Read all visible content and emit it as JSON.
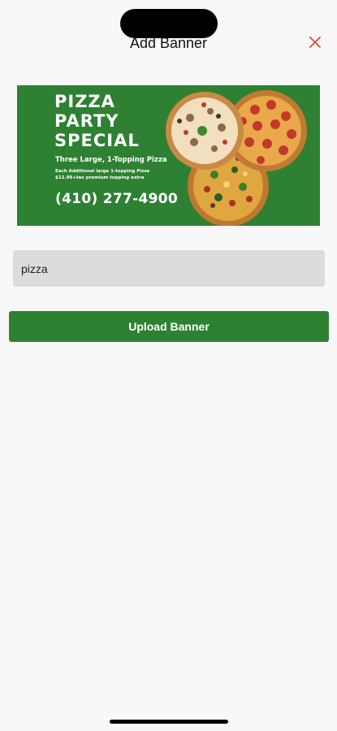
{
  "sheet": {
    "title": "Add Banner"
  },
  "banner": {
    "title": "PIZZA\nPARTY\nSPECIAL",
    "subtitle": "Three Large, 1-Topping Pizza",
    "detail_line1": "Each Additional large  1-topping Pizza",
    "detail_line2": "$11.99+tax  premium topping extra",
    "phone": "(410) 277-4900"
  },
  "form": {
    "name_value": "pizza",
    "upload_label": "Upload Banner"
  },
  "colors": {
    "accent": "#2e8133",
    "close": "#e8443a",
    "input_bg": "#dcdcdc"
  }
}
